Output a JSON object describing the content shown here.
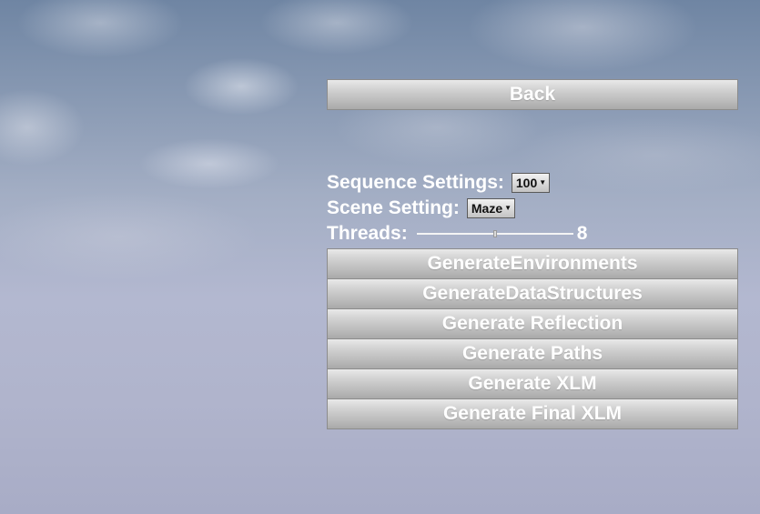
{
  "back_button": {
    "label": "Back"
  },
  "settings": {
    "sequence": {
      "label": "Sequence Settings:",
      "selected": "100"
    },
    "scene": {
      "label": "Scene Setting:",
      "selected": "Maze"
    },
    "threads": {
      "label": "Threads:",
      "value": "8",
      "level_fraction": 0.5
    }
  },
  "actions": [
    {
      "label": "GenerateEnvironments"
    },
    {
      "label": "GenerateDataStructures"
    },
    {
      "label": "Generate Reflection"
    },
    {
      "label": "Generate Paths"
    },
    {
      "label": "Generate XLM"
    },
    {
      "label": "Generate Final XLM"
    }
  ],
  "icons": {
    "dropdown_caret": "caret-down-icon"
  },
  "colors": {
    "button_top": "#e9e9e9",
    "button_bottom": "#a9a9a9",
    "text": "#ffffff",
    "sky_top": "#6f85a3",
    "sky_bottom": "#a8acc6"
  }
}
